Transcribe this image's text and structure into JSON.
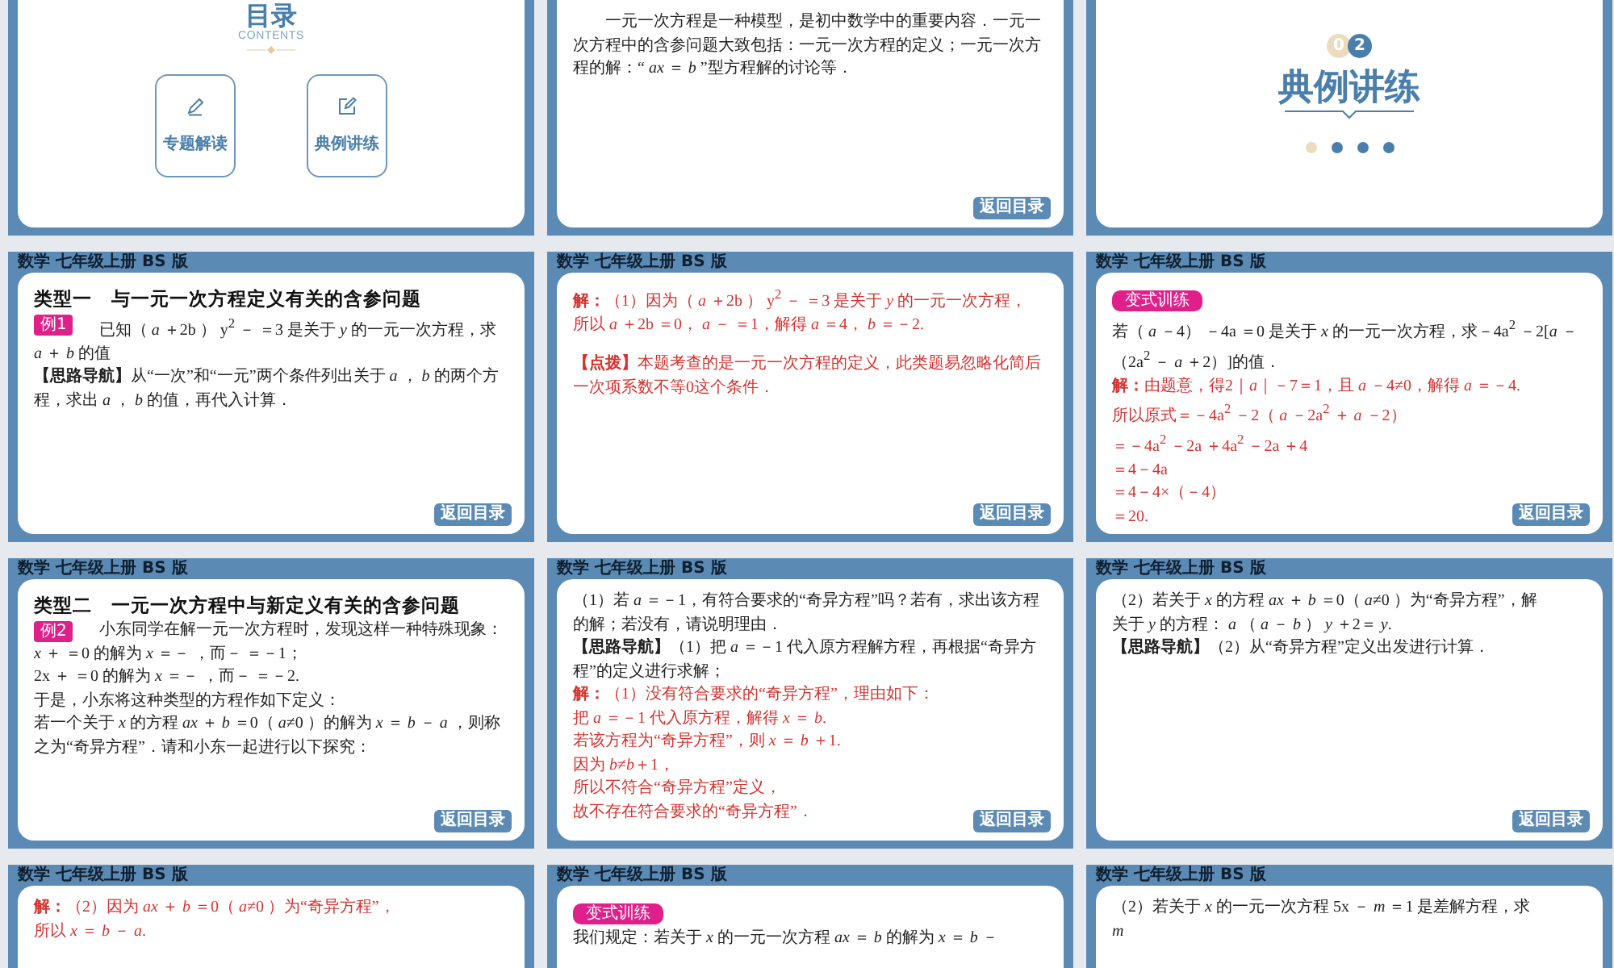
{
  "slides": [
    {
      "kind": "toc",
      "title": "目录",
      "subtitle": "CONTENTS",
      "items": [
        {
          "label": "专题解读"
        },
        {
          "label": "典例讲练"
        }
      ]
    },
    {
      "kind": "text",
      "lines": [
        {
          "kind": "para",
          "text": "一元一次方程是一种模型，是初中数学中的重要内容．一元一次方程中的含参问题大致包括：一元一次方程的定义；一元一次方程的解：“ *ax* ＝ *b* ”型方程解的讨论等．"
        }
      ],
      "back_button": "返回目录"
    },
    {
      "kind": "section",
      "digits": [
        {
          "text": "0",
          "selected": false
        },
        {
          "text": "2",
          "selected": true
        }
      ],
      "title": "典例讲练",
      "dots": [
        {
          "selected": true
        },
        {
          "selected": false
        },
        {
          "selected": false
        },
        {
          "selected": false
        }
      ]
    },
    {
      "kind": "text",
      "header": "数学 七年级上册 BS 版",
      "lines": [
        {
          "kind": "title",
          "text": "类型一　与一元一次方程定义有关的含参问题"
        },
        {
          "kind": "example",
          "tag": "例1",
          "text": "已知（ *a* ＋2b ） y$^{2}$ － ＝3 是关于 *y* 的一元一次方程，求"
        },
        {
          "kind": "text",
          "text": "*a* ＋ *b* 的值"
        },
        {
          "kind": "text",
          "text": "**【思路导航】**从“一次”和“一元”两个条件列出关于 *a* ， *b* 的两个方程，求出 *a* ， *b* 的值，再代入计算．"
        }
      ],
      "back_button": "返回目录"
    },
    {
      "kind": "text",
      "header": "数学 七年级上册 BS 版",
      "lines": [
        {
          "kind": "red",
          "text": "**解：**（1）因为（ *a* ＋2b ） y$^{2}$ － ＝3 是关于 *y* 的一元一次方程，"
        },
        {
          "kind": "red",
          "text": "所以 *a* ＋2b ＝0， *a* － ＝1，解得 *a* ＝4， *b* ＝－2."
        },
        {
          "kind": "note",
          "text": "**【点拨】**本题考查的是一元一次方程的定义，此类题易忽略化简后一次项系数不等0这个条件．"
        }
      ],
      "back_button": "返回目录"
    },
    {
      "kind": "text",
      "header": "数学 七年级上册 BS 版",
      "lines": [
        {
          "kind": "tag",
          "tag": "变式训练"
        },
        {
          "kind": "text",
          "text": "若（ *a* －4） －4a ＝0 是关于 *x* 的一元一次方程，求－4a$^{2}$ －2[*a* －（2a$^{2}$ － *a* ＋2）]的值．"
        },
        {
          "kind": "red",
          "text": "**解：**由题意，得2｜*a*｜－7＝1，且 *a* －4≠0，解得 *a* ＝－4."
        },
        {
          "kind": "red",
          "text": "所以原式＝－4a$^{2}$ －2（ *a* －2a$^{2}$ ＋ *a* －2）"
        },
        {
          "kind": "red",
          "text": "＝－4a$^{2}$ －2a ＋4a$^{2}$ －2a ＋4"
        },
        {
          "kind": "red",
          "text": "＝4－4a"
        },
        {
          "kind": "red",
          "text": "＝4－4×（－4）"
        },
        {
          "kind": "red",
          "text": "＝20."
        }
      ],
      "back_button": "返回目录"
    },
    {
      "kind": "text",
      "header": "数学 七年级上册 BS 版",
      "lines": [
        {
          "kind": "title",
          "text": "类型二　一元一次方程中与新定义有关的含参问题"
        },
        {
          "kind": "example",
          "tag": "例2",
          "text": "小东同学在解一元一次方程时，发现这样一种特殊现象："
        },
        {
          "kind": "text",
          "text": "*x* ＋ ＝0 的解为 *x* ＝－ ，而－ ＝－1；"
        },
        {
          "kind": "text",
          "text": "2x ＋ ＝0 的解为 *x* ＝－ ，而－ ＝－2."
        },
        {
          "kind": "text",
          "text": "于是，小东将这种类型的方程作如下定义："
        },
        {
          "kind": "text",
          "text": "若一个关于 *x* 的方程 *ax* ＋ *b* ＝0（ *a*≠0 ）的解为 *x* ＝ *b* － *a* ，则称"
        },
        {
          "kind": "text",
          "text": "之为“奇异方程”．请和小东一起进行以下探究："
        }
      ],
      "back_button": "返回目录"
    },
    {
      "kind": "text",
      "header": "数学 七年级上册 BS 版",
      "lines": [
        {
          "kind": "text",
          "text": "（1）若 *a* ＝－1，有符合要求的“奇异方程”吗？若有，求出该方程的解；若没有，请说明理由．"
        },
        {
          "kind": "text",
          "text": "**【思路导航】**（1）把 *a* ＝－1 代入原方程解方程，再根据“奇异方程”的定义进行求解；"
        },
        {
          "kind": "red",
          "text": "**解：**（1）没有符合要求的“奇异方程”，理由如下："
        },
        {
          "kind": "red",
          "text": "把 *a* ＝－1 代入原方程，解得 *x* ＝ *b*."
        },
        {
          "kind": "red",
          "text": "若该方程为“奇异方程”，则 *x* ＝ *b* ＋1."
        },
        {
          "kind": "red",
          "text": "因为 *b*≠*b*＋1，"
        },
        {
          "kind": "red",
          "text": "所以不符合“奇异方程”定义，"
        },
        {
          "kind": "red",
          "text": "故不存在符合要求的“奇异方程”．"
        }
      ],
      "back_button": "返回目录"
    },
    {
      "kind": "text",
      "header": "数学 七年级上册 BS 版",
      "lines": [
        {
          "kind": "text",
          "text": "（2）若关于 *x* 的方程 *ax* ＋ *b* ＝0（ *a*≠0 ）为“奇异方程”，解"
        },
        {
          "kind": "text",
          "text": "关于 *y* 的方程： *a* （ *a* － *b* ） *y* ＋2＝ *y*."
        },
        {
          "kind": "text",
          "text": "**【思路导航】**（2）从“奇异方程”定义出发进行计算．"
        }
      ],
      "back_button": "返回目录"
    },
    {
      "kind": "text",
      "header": "数学 七年级上册 BS 版",
      "lines": [
        {
          "kind": "red",
          "text": "**解：**（2）因为 *ax* ＋ *b* ＝0（ *a*≠0 ）为“奇异方程”，"
        },
        {
          "kind": "red",
          "text": "所以 *x* ＝ *b* － *a*."
        }
      ]
    },
    {
      "kind": "text",
      "header": "数学 七年级上册 BS 版",
      "lines": [
        {
          "kind": "tag",
          "tag": "变式训练"
        },
        {
          "kind": "text",
          "text": "我们规定：若关于 *x* 的一元一次方程 *ax* ＝ *b* 的解为 *x* ＝ *b* －"
        }
      ]
    },
    {
      "kind": "text",
      "header": "数学 七年级上册 BS 版",
      "lines": [
        {
          "kind": "text",
          "text": "（2）若关于 *x* 的一元一次方程 5x － *m* ＝1 是差解方程，求"
        },
        {
          "kind": "text",
          "text": "*m*"
        }
      ]
    }
  ]
}
